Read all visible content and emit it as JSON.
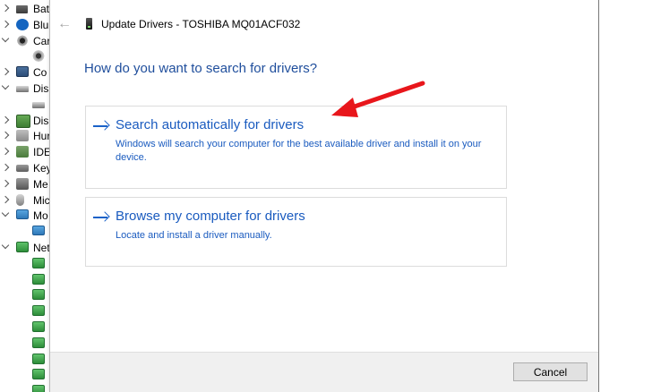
{
  "tree": {
    "items": [
      {
        "label": "Bat",
        "icon": "battery-icon",
        "expanded": false
      },
      {
        "label": "Blu",
        "icon": "bluetooth-icon",
        "expanded": false
      },
      {
        "label": "Car",
        "icon": "camera-icon",
        "expanded": true
      },
      {
        "label": "",
        "icon": "webcam-icon",
        "expanded": null
      },
      {
        "label": "Co",
        "icon": "computer-icon",
        "expanded": false
      },
      {
        "label": "Disl",
        "icon": "disk-icon",
        "expanded": true
      },
      {
        "label": "",
        "icon": "disk-drive-icon",
        "expanded": null
      },
      {
        "label": "Disp",
        "icon": "display-adapter-icon",
        "expanded": false
      },
      {
        "label": "Hur",
        "icon": "hid-icon",
        "expanded": false
      },
      {
        "label": "IDE",
        "icon": "ide-icon",
        "expanded": false
      },
      {
        "label": "Key",
        "icon": "keyboard-icon",
        "expanded": false
      },
      {
        "label": "Me",
        "icon": "memory-icon",
        "expanded": false
      },
      {
        "label": "Mic",
        "icon": "mouse-icon",
        "expanded": false
      },
      {
        "label": "Mo",
        "icon": "monitor-icon",
        "expanded": true
      },
      {
        "label": "",
        "icon": "monitor-device-icon",
        "expanded": null
      },
      {
        "label": "Net",
        "icon": "network-icon",
        "expanded": true
      },
      {
        "label": "",
        "icon": "network-adapter-icon",
        "expanded": null
      },
      {
        "label": "",
        "icon": "network-adapter-icon",
        "expanded": null
      },
      {
        "label": "",
        "icon": "network-adapter-icon",
        "expanded": null
      },
      {
        "label": "",
        "icon": "network-adapter-icon",
        "expanded": null
      },
      {
        "label": "",
        "icon": "network-adapter-icon",
        "expanded": null
      },
      {
        "label": "",
        "icon": "network-adapter-icon",
        "expanded": null
      },
      {
        "label": "",
        "icon": "network-adapter-icon",
        "expanded": null
      },
      {
        "label": "",
        "icon": "network-adapter-icon",
        "expanded": null
      },
      {
        "label": "",
        "icon": "network-adapter-icon",
        "expanded": null
      }
    ]
  },
  "dialog": {
    "title": "Update Drivers - TOSHIBA MQ01ACF032",
    "back_icon": "back-arrow-icon",
    "device_icon": "disk-drive-icon",
    "heading": "How do you want to search for drivers?",
    "options": [
      {
        "title": "Search automatically for drivers",
        "description": "Windows will search your computer for the best available driver and install it on your device.",
        "icon": "arrow-right-icon"
      },
      {
        "title": "Browse my computer for drivers",
        "description": "Locate and install a driver manually.",
        "icon": "arrow-right-icon"
      }
    ],
    "cancel_label": "Cancel"
  },
  "annotation": {
    "color": "#e8161b",
    "points_to": "Search automatically for drivers"
  },
  "colors": {
    "link_blue": "#1a5bbf",
    "heading_blue": "#1f4e9c",
    "footer_bg": "#f0f0f0"
  }
}
